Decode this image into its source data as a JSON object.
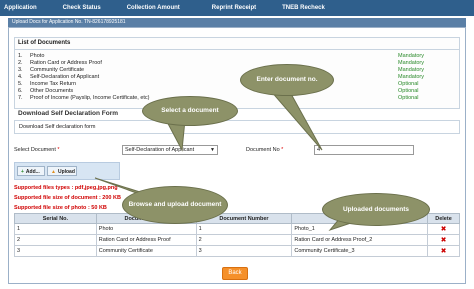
{
  "nav": {
    "items": [
      {
        "label": "Application"
      },
      {
        "label": "Check Status"
      },
      {
        "label": "Collection Amount"
      },
      {
        "label": "Reprint Receipt"
      },
      {
        "label": "TNEB Recheck"
      }
    ]
  },
  "subtitle": "Upload Docs for Application No. TN-826178925181",
  "document_list": {
    "title": "List of Documents",
    "items": [
      {
        "num": "1.",
        "name": "Photo",
        "req": "Mandatory"
      },
      {
        "num": "2.",
        "name": "Ration Card or Address Proof",
        "req": "Mandatory"
      },
      {
        "num": "3.",
        "name": "Community Certificate",
        "req": "Mandatory"
      },
      {
        "num": "4.",
        "name": "Self-Declaration of Applicant",
        "req": "Mandatory"
      },
      {
        "num": "5.",
        "name": "Income Tax Return",
        "req": "Optional"
      },
      {
        "num": "6.",
        "name": "Other Documents",
        "req": "Optional"
      },
      {
        "num": "7.",
        "name": "Proof of Income (Payslip, Income Certificate, etc)",
        "req": "Optional"
      }
    ]
  },
  "self_declaration": {
    "title": "Download Self Declaration Form",
    "link": "Download Self declaration form"
  },
  "form": {
    "select_label": "Select Document",
    "select_value": "Self-Declaration of Applicant",
    "docno_label": "Document No",
    "docno_value": "4",
    "required_mark": "*"
  },
  "buttons": {
    "add": "Add...",
    "upload": "Upload",
    "back": "Back"
  },
  "notes": {
    "types": "Supported files types : pdf,jpeg,jpg,png",
    "doc_size": "Supported file size of document : 200 KB",
    "photo_size": "Supported file size of photo : 50 KB"
  },
  "table": {
    "headers": [
      "Serial No.",
      "Document Name",
      "Document Number",
      "",
      "Delete"
    ],
    "rows": [
      {
        "serial": "1",
        "name": "Photo",
        "docno": "1",
        "file": "Photo_1"
      },
      {
        "serial": "2",
        "name": "Ration Card or Address Proof",
        "docno": "2",
        "file": "Ration Card or Address Proof_2"
      },
      {
        "serial": "3",
        "name": "Community Certificate",
        "docno": "3",
        "file": "Community Certificate_3"
      }
    ],
    "delete_glyph": "✖"
  },
  "callouts": {
    "enter_doc_no": "Enter document no.",
    "select_doc": "Select a document",
    "browse_upload": "Browse and upload document",
    "uploaded_docs": "Uploaded documents"
  },
  "colors": {
    "nav_bg": "#2f5f8c",
    "callout": "#8d9268",
    "mandatory": "#2a8a2a",
    "note_red": "#d00000",
    "back_btn": "#f5902a"
  }
}
